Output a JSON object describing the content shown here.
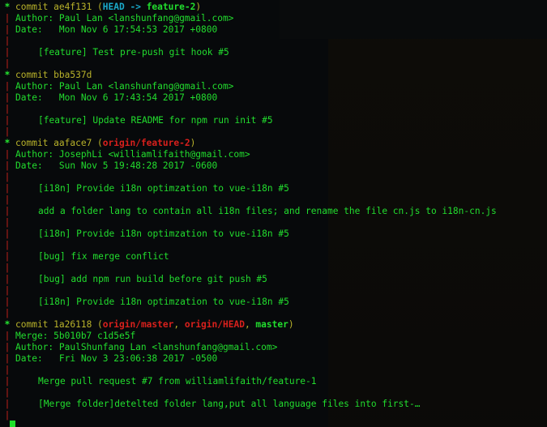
{
  "terminal": {
    "commits": [
      {
        "hash": "ae4f131",
        "refs": [
          {
            "text": "HEAD -> ",
            "style": "cyan"
          },
          {
            "text": "feature-2",
            "style": "gbold"
          }
        ],
        "merge": null,
        "author": "Paul Lan <lanshunfang@gmail.com>",
        "date": "Mon Nov 6 17:54:53 2017 +0800",
        "messages": [
          "[feature] Test pre-push git hook #5"
        ]
      },
      {
        "hash": "bba537d",
        "refs": [],
        "merge": null,
        "author": "Paul Lan <lanshunfang@gmail.com>",
        "date": "Mon Nov 6 17:43:54 2017 +0800",
        "messages": [
          "[feature] Update README for npm run init #5"
        ]
      },
      {
        "hash": "aaface7",
        "refs": [
          {
            "text": "origin/feature-2",
            "style": "red"
          }
        ],
        "merge": null,
        "author": "JosephLi <williamlifaith@gmail.com>",
        "date": "Sun Nov 5 19:48:28 2017 -0600",
        "messages": [
          "[i18n] Provide i18n optimzation to vue-i18n #5",
          "add a folder lang to contain all i18n files; and rename the file cn.js to i18n-cn.js",
          "[i18n] Provide i18n optimzation to vue-i18n #5",
          "[bug] fix merge conflict",
          "[bug] add npm run build before git push #5",
          "[i18n] Provide i18n optimzation to vue-i18n #5"
        ]
      },
      {
        "hash": "1a26118",
        "refs": [
          {
            "text": "origin/master",
            "style": "red"
          },
          {
            "text": ", ",
            "style": "yellow"
          },
          {
            "text": "origin/HEAD",
            "style": "red"
          },
          {
            "text": ", ",
            "style": "yellow"
          },
          {
            "text": "master",
            "style": "gbold"
          }
        ],
        "merge": "5b010b7 c1d5e5f",
        "author": "PaulShunfang Lan <lanshunfang@gmail.com>",
        "date": "Fri Nov 3 23:06:38 2017 -0500",
        "messages": [
          "Merge pull request #7 from williamlifaith/feature-1",
          "[Merge folder]detelted folder lang,put all language files into first-…"
        ]
      }
    ],
    "labels": {
      "commit": "commit ",
      "author": "Author: ",
      "merge": "Merge: ",
      "date": "Date:   ",
      "graph_node": "*",
      "graph_edge": "|"
    },
    "colors": {
      "hash": "#b8b22a",
      "text": "#22dd2e",
      "graph_edge": "#c8221c",
      "head": "#1aa9c9",
      "remote_branch": "#d8201c"
    }
  }
}
